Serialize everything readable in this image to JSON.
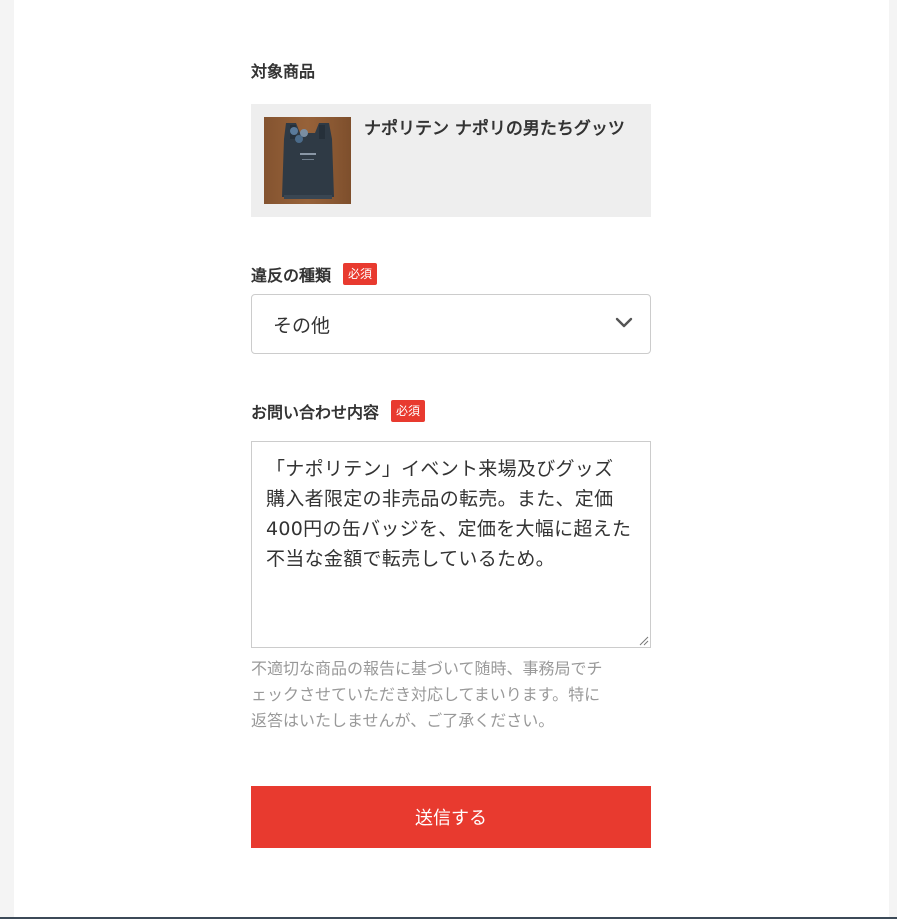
{
  "target_product": {
    "label": "対象商品",
    "name": "ナポリテン ナポリの男たちグッツ",
    "thumbnail": "product-photo"
  },
  "violation_type": {
    "label": "違反の種類",
    "required_badge": "必須",
    "selected": "その他",
    "icon": "chevron-down-icon"
  },
  "inquiry": {
    "label": "お問い合わせ内容",
    "required_badge": "必須",
    "value": "「ナポリテン」イベント来場及びグッズ\n購入者限定の非売品の転売。また、定価\n400円の缶バッジを、定価を大幅に超えた\n不当な金額で転売しているため。"
  },
  "helper_text": "不適切な商品の報告に基づいて随時、事務局でチ\nェックさせていただき対応してまいります。特に\n返答はいたしませんが、ご了承ください。",
  "submit_label": "送信する",
  "colors": {
    "accent": "#e83a2f",
    "card_bg": "#eeeeee",
    "border": "#cccccc",
    "muted_text": "#999999"
  }
}
